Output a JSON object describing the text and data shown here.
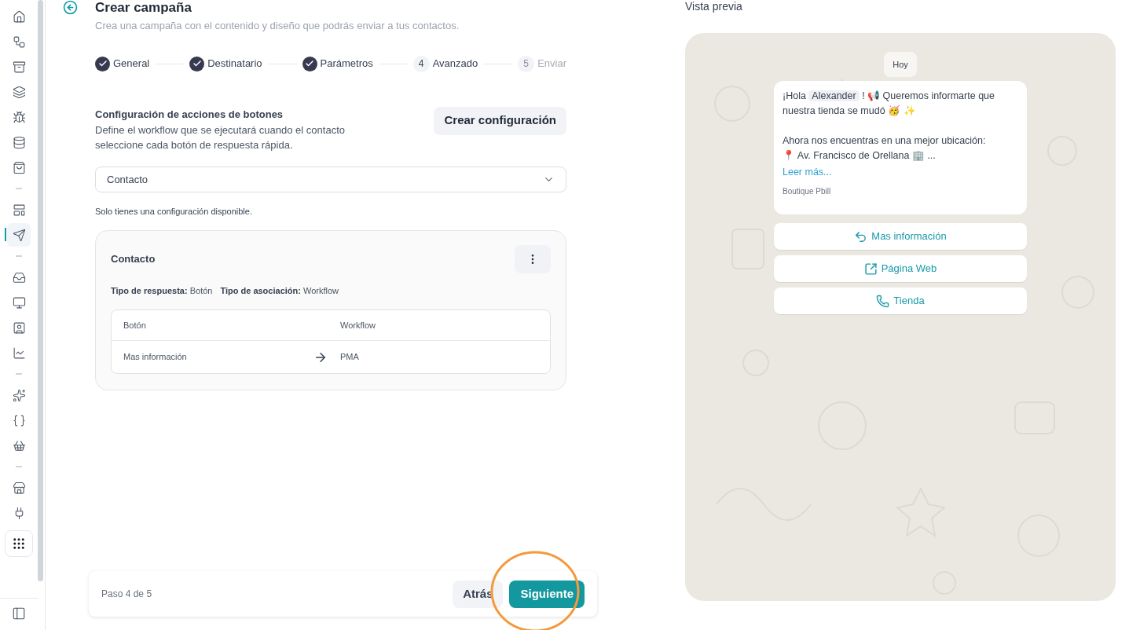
{
  "sidebar": {
    "items": [
      {
        "kind": "icon",
        "selected": false
      },
      {
        "kind": "icon",
        "selected": false
      },
      {
        "kind": "icon",
        "selected": false
      },
      {
        "kind": "icon",
        "selected": false
      },
      {
        "kind": "icon",
        "selected": false
      },
      {
        "kind": "icon",
        "selected": false
      },
      {
        "kind": "icon",
        "selected": false
      },
      {
        "kind": "divider"
      },
      {
        "kind": "icon",
        "selected": false
      },
      {
        "kind": "icon",
        "selected": true
      },
      {
        "kind": "divider"
      },
      {
        "kind": "icon",
        "selected": false
      },
      {
        "kind": "icon",
        "selected": false
      },
      {
        "kind": "icon",
        "selected": false
      },
      {
        "kind": "icon",
        "selected": false
      },
      {
        "kind": "divider"
      },
      {
        "kind": "icon",
        "selected": false
      },
      {
        "kind": "icon",
        "selected": false
      },
      {
        "kind": "icon",
        "selected": false
      },
      {
        "kind": "divider"
      },
      {
        "kind": "icon",
        "selected": false
      },
      {
        "kind": "icon",
        "selected": false
      }
    ]
  },
  "header": {
    "title": "Crear campaña",
    "subtitle": "Crea una campaña con el contenido y diseño que podrás enviar a tus contactos."
  },
  "steps": [
    {
      "label": "General",
      "kind": "done"
    },
    {
      "label": "Destinatario",
      "kind": "done"
    },
    {
      "label": "Parámetros",
      "kind": "done"
    },
    {
      "label": "Avanzado",
      "kind": "current",
      "number": "4"
    },
    {
      "label": "Enviar",
      "kind": "upcoming",
      "number": "5"
    }
  ],
  "config": {
    "title": "Configuración de acciones de botones",
    "description": "Define el workflow que se ejecutará cuando el contacto seleccione cada botón de respuesta rápida.",
    "create_button": "Crear configuración",
    "select_value": "Contacto",
    "note": "Solo tienes una configuración disponible."
  },
  "card": {
    "title": "Contacto",
    "response_type_label": "Tipo de respuesta:",
    "response_type": "Botón",
    "association_label": "Tipo de asociación:",
    "association": "Workflow",
    "table": {
      "columns": [
        "Botón",
        "Workflow"
      ],
      "rows": [
        {
          "button": "Mas información",
          "workflow": "PMA"
        }
      ]
    }
  },
  "footer": {
    "step": "Paso 4 de 5",
    "back": "Atrás",
    "next": "Siguiente",
    "next_highlighted": true
  },
  "preview": {
    "title": "Vista previa",
    "date": "Hoy",
    "message": {
      "greeting": "¡Hola",
      "variable": "Alexander",
      "line1": "! 📢 Queremos informarte que nuestra tienda se mudó 🥳 ✨",
      "line2": "Ahora nos encuentras en una mejor ubicación:",
      "line3": "📍 Av. Francisco de Orellana 🏢 ...",
      "read_more": "Leer más...",
      "sender": "Boutique Pbill"
    },
    "buttons": [
      {
        "kind": "reply",
        "label": "Mas información"
      },
      {
        "kind": "link",
        "label": "Página Web"
      },
      {
        "kind": "call",
        "label": "Tienda"
      }
    ]
  }
}
